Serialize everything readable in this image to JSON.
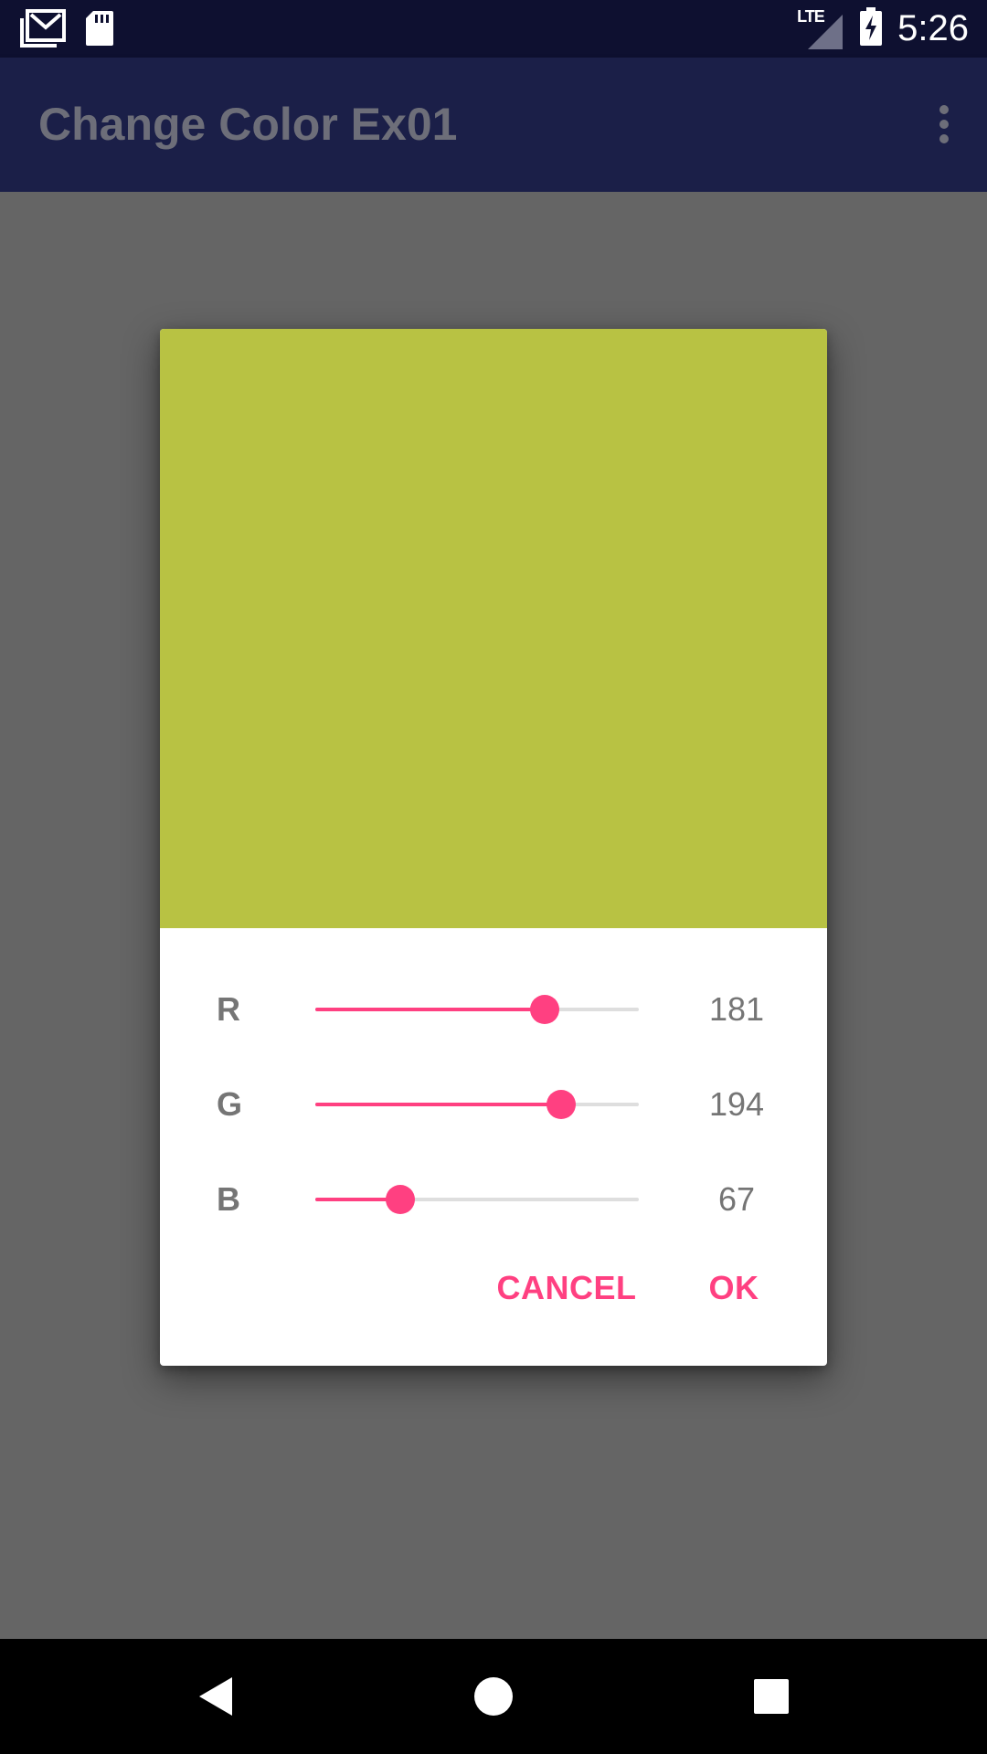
{
  "status_bar": {
    "time": "5:26",
    "network": "LTE",
    "icons": [
      "gmail-icon",
      "sd-card-icon",
      "signal-icon",
      "battery-charging-icon"
    ]
  },
  "app_bar": {
    "title": "Change Color Ex01",
    "menu_icon": "more-vert-icon"
  },
  "dialog": {
    "preview_color": "#b8c243",
    "sliders": [
      {
        "label": "R",
        "value": "181",
        "fraction": 0.7098
      },
      {
        "label": "G",
        "value": "194",
        "fraction": 0.7608
      },
      {
        "label": "B",
        "value": "67",
        "fraction": 0.2627
      }
    ],
    "cancel_label": "CANCEL",
    "ok_label": "OK"
  },
  "nav_bar": {
    "icons": [
      "back-icon",
      "home-icon",
      "recents-icon"
    ]
  },
  "colors": {
    "accent": "#ff4081",
    "primary_dark": "#0e1030",
    "primary": "#1b1f48",
    "scrim": "#656565"
  }
}
